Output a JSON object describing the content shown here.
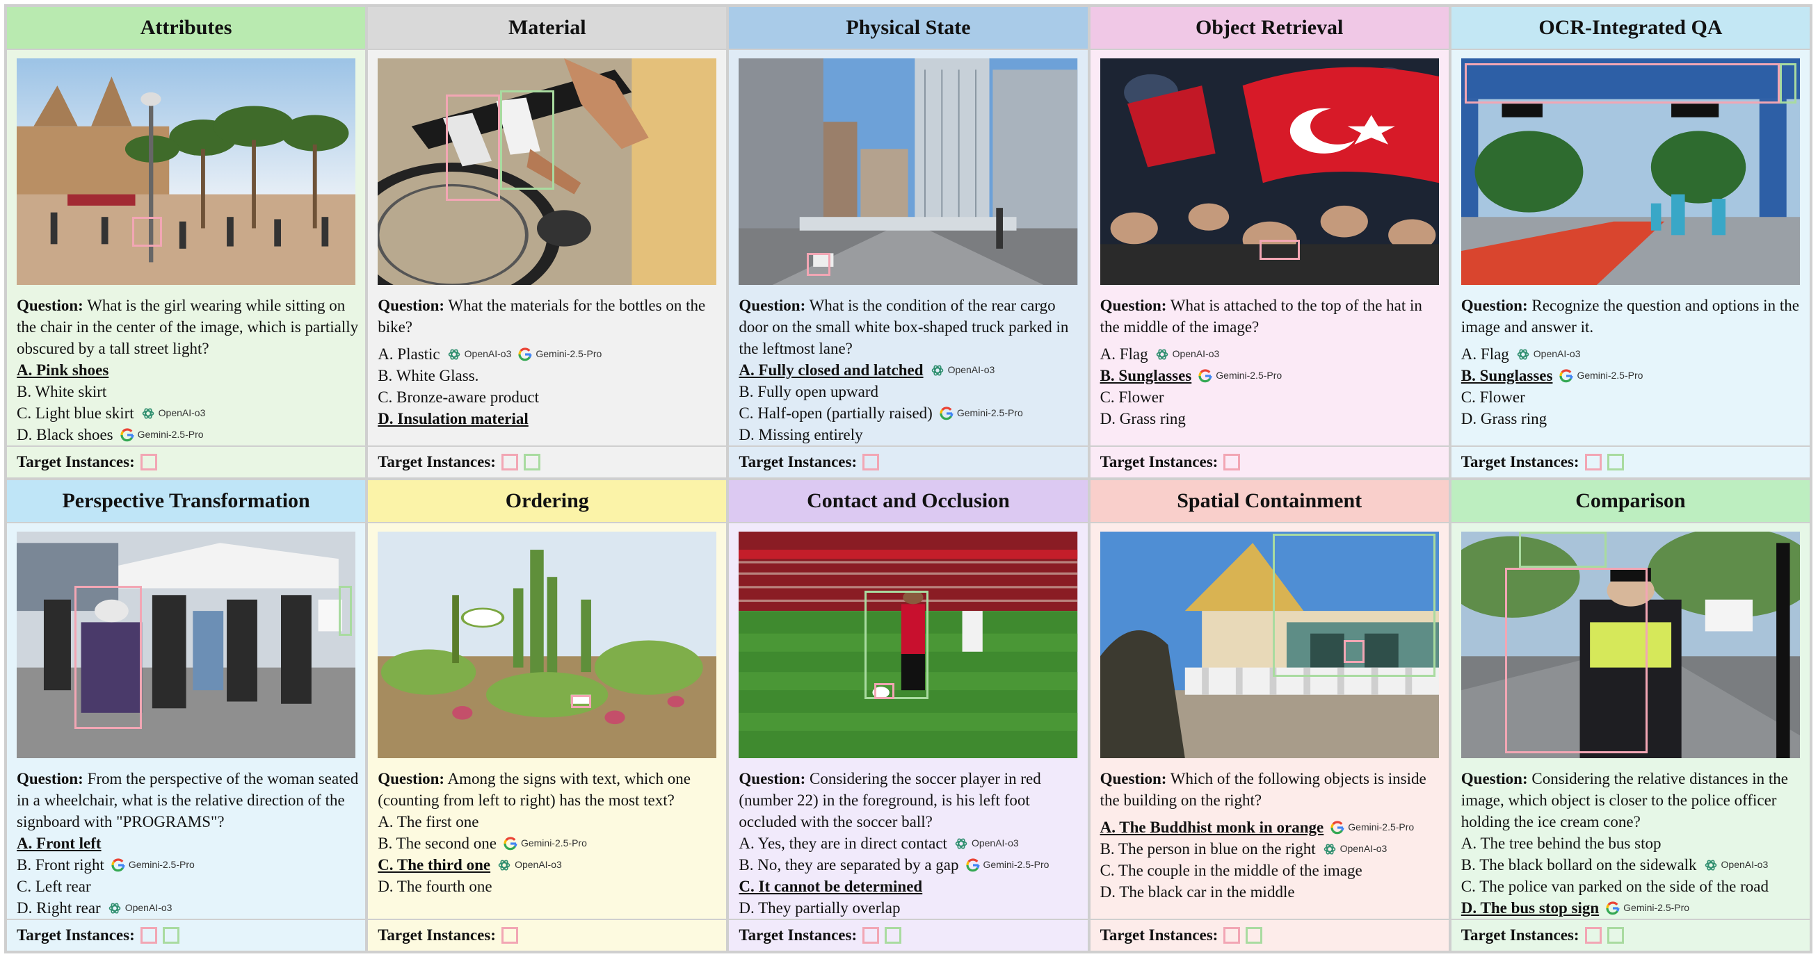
{
  "labels": {
    "question_prefix": "Question:",
    "target_instances": "Target Instances:"
  },
  "model_names": {
    "openai": "OpenAI-o3",
    "gemini": "Gemini-2.5-Pro"
  },
  "colors": {
    "pink_box": "#f2a6b4",
    "green_box": "#a9dba0",
    "panel_border": "#cfcfcf"
  },
  "icons": {
    "openai": "openai-logo-icon",
    "gemini": "google-g-logo-icon"
  },
  "panels": [
    {
      "title": "Attributes",
      "header_color": "#b9eab0",
      "body_color": "#e9f6e4",
      "question": "What is the girl wearing while sitting on the chair in the center of the image, which is partially obscured by a tall street light?",
      "options": [
        {
          "text": "A. Pink shoes",
          "correct": true,
          "models": []
        },
        {
          "text": "B. White skirt",
          "correct": false,
          "models": []
        },
        {
          "text": "C. Light blue skirt",
          "correct": false,
          "models": [
            "openai"
          ]
        },
        {
          "text": "D. Black shoes",
          "correct": false,
          "models": [
            "gemini"
          ]
        }
      ],
      "targets": [
        "pink"
      ]
    },
    {
      "title": "Material",
      "header_color": "#d9d9d9",
      "body_color": "#f1f1f1",
      "question": "What the materials for the bottles on the bike?",
      "options": [
        {
          "text": "A. Plastic",
          "correct": false,
          "models": [
            "openai",
            "gemini"
          ],
          "gap": true
        },
        {
          "text": "B. White Glass.",
          "correct": false,
          "models": []
        },
        {
          "text": "C. Bronze-aware product",
          "correct": false,
          "models": []
        },
        {
          "text": "D. Insulation material",
          "correct": true,
          "models": []
        }
      ],
      "targets": [
        "pink",
        "green"
      ]
    },
    {
      "title": "Physical State",
      "header_color": "#a9cbe8",
      "body_color": "#dfebf6",
      "question": "What is the condition of the rear cargo door on the small white box-shaped truck parked in the leftmost lane?",
      "options": [
        {
          "text": "A. Fully closed and latched",
          "correct": true,
          "models": [
            "openai"
          ]
        },
        {
          "text": "B. Fully open upward",
          "correct": false,
          "models": []
        },
        {
          "text": "C. Half-open (partially raised)",
          "correct": false,
          "models": [
            "gemini"
          ]
        },
        {
          "text": "D. Missing entirely",
          "correct": false,
          "models": []
        }
      ],
      "targets": [
        "pink"
      ]
    },
    {
      "title": "Object Retrieval",
      "header_color": "#f0c8e6",
      "body_color": "#fbeaf6",
      "question": " What is attached to the top of the hat in the middle of the image?",
      "options": [
        {
          "text": "A. Flag",
          "correct": false,
          "models": [
            "openai"
          ],
          "gap": true
        },
        {
          "text": "B. Sunglasses",
          "correct": true,
          "models": [
            "gemini"
          ]
        },
        {
          "text": "C. Flower",
          "correct": false,
          "models": []
        },
        {
          "text": "D. Grass ring",
          "correct": false,
          "models": []
        }
      ],
      "targets": [
        "pink"
      ]
    },
    {
      "title": "OCR-Integrated QA",
      "header_color": "#c3e7f4",
      "body_color": "#e6f5fb",
      "question": " Recognize the question and options in the image and answer it.",
      "options": [
        {
          "text": "A. Flag",
          "correct": false,
          "models": [
            "openai"
          ],
          "gap": true
        },
        {
          "text": "B. Sunglasses",
          "correct": true,
          "models": [
            "gemini"
          ]
        },
        {
          "text": "C. Flower",
          "correct": false,
          "models": []
        },
        {
          "text": "D. Grass ring",
          "correct": false,
          "models": []
        }
      ],
      "targets": [
        "pink",
        "green"
      ]
    },
    {
      "title": "Perspective Transformation",
      "header_color": "#bfe5f7",
      "body_color": "#e5f4fb",
      "question": "From the perspective of the woman seated in a wheelchair, what is the relative direction of the signboard with \"PROGRAMS\"?",
      "options": [
        {
          "text": "A. Front left",
          "correct": true,
          "models": []
        },
        {
          "text": "B. Front right",
          "correct": false,
          "models": [
            "gemini"
          ]
        },
        {
          "text": "C. Left rear",
          "correct": false,
          "models": []
        },
        {
          "text": "D. Right rear",
          "correct": false,
          "models": [
            "openai"
          ]
        }
      ],
      "targets": [
        "pink",
        "green"
      ]
    },
    {
      "title": "Ordering",
      "header_color": "#fbf3a8",
      "body_color": "#fdfae0",
      "question": "Among the signs with text, which one (counting from left to right) has the most text?",
      "options": [
        {
          "text": "A. The first one",
          "correct": false,
          "models": []
        },
        {
          "text": "B. The second one",
          "correct": false,
          "models": [
            "gemini"
          ]
        },
        {
          "text": "C. The third one",
          "correct": true,
          "models": [
            "openai"
          ]
        },
        {
          "text": "D. The fourth one",
          "correct": false,
          "models": []
        }
      ],
      "targets": [
        "pink"
      ]
    },
    {
      "title": "Contact and Occlusion",
      "header_color": "#dcc9f2",
      "body_color": "#f1eafb",
      "question": "Considering the soccer player in red (number 22) in the foreground, is his left foot occluded with the soccer ball?",
      "options": [
        {
          "text": "A. Yes, they are in direct contact",
          "correct": false,
          "models": [
            "openai"
          ]
        },
        {
          "text": "B. No, they are separated by a gap",
          "correct": false,
          "models": [
            "gemini"
          ]
        },
        {
          "text": "C. It cannot be determined",
          "correct": true,
          "models": []
        },
        {
          "text": "D. They partially overlap",
          "correct": false,
          "models": []
        }
      ],
      "targets": [
        "pink",
        "green"
      ]
    },
    {
      "title": "Spatial Containment",
      "header_color": "#f9cfcb",
      "body_color": "#fdecea",
      "question": " Which of the following objects is inside the building on the right?",
      "options": [
        {
          "text": "A. The Buddhist monk in orange",
          "correct": true,
          "models": [
            "gemini"
          ],
          "gap": true
        },
        {
          "text": "B. The person in blue on the right",
          "correct": false,
          "models": [
            "openai"
          ]
        },
        {
          "text": "C. The couple in the middle of the image",
          "correct": false,
          "models": []
        },
        {
          "text": "D. The black car in the middle",
          "correct": false,
          "models": []
        }
      ],
      "targets": [
        "pink",
        "green"
      ]
    },
    {
      "title": "Comparison",
      "header_color": "#bdeec0",
      "body_color": "#e6f7e7",
      "question": "Considering the relative distances in the image, which object is closer to the police officer holding the ice cream cone?",
      "options": [
        {
          "text": "A. The tree behind the bus stop",
          "correct": false,
          "models": []
        },
        {
          "text": "B. The black bollard on the sidewalk",
          "correct": false,
          "models": [
            "openai"
          ]
        },
        {
          "text": "C. The police van parked on the side of the road",
          "correct": false,
          "models": []
        },
        {
          "text": "D. The bus stop sign",
          "correct": true,
          "models": [
            "gemini"
          ]
        }
      ],
      "targets": [
        "pink",
        "green"
      ]
    }
  ]
}
